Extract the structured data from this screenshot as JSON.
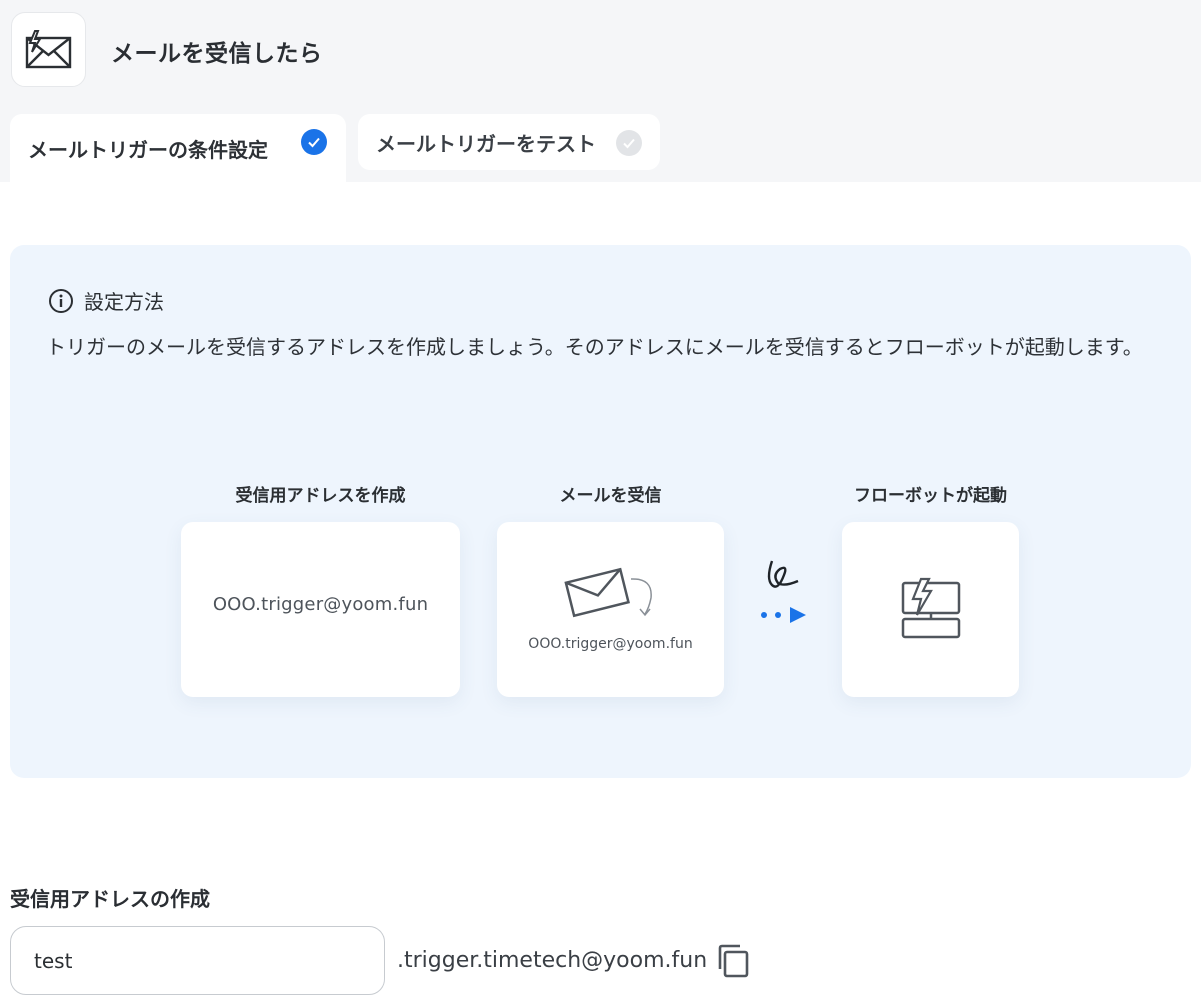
{
  "header": {
    "title": "メールを受信したら",
    "icon": "mail-trigger-icon"
  },
  "tabs": [
    {
      "label": "メールトリガーの条件設定",
      "state": "completed"
    },
    {
      "label": "メールトリガーをテスト",
      "state": "pending"
    }
  ],
  "info": {
    "heading": "設定方法",
    "body": "トリガーのメールを受信するアドレスを作成しましょう。そのアドレスにメールを受信するとフローボットが起動します。"
  },
  "steps": [
    {
      "label": "受信用アドレスを作成",
      "address": "OOO.trigger@yoom.fun"
    },
    {
      "label": "メールを受信",
      "address": "OOO.trigger@yoom.fun"
    },
    {
      "label": "フローボットが起動"
    }
  ],
  "form": {
    "label": "受信用アドレスの作成",
    "input_value": "test",
    "domain_suffix": ".trigger.timetech@yoom.fun"
  },
  "colors": {
    "accent": "#1a73e8",
    "panel_bg": "#eef5fd",
    "top_bg": "#f5f6f8"
  }
}
